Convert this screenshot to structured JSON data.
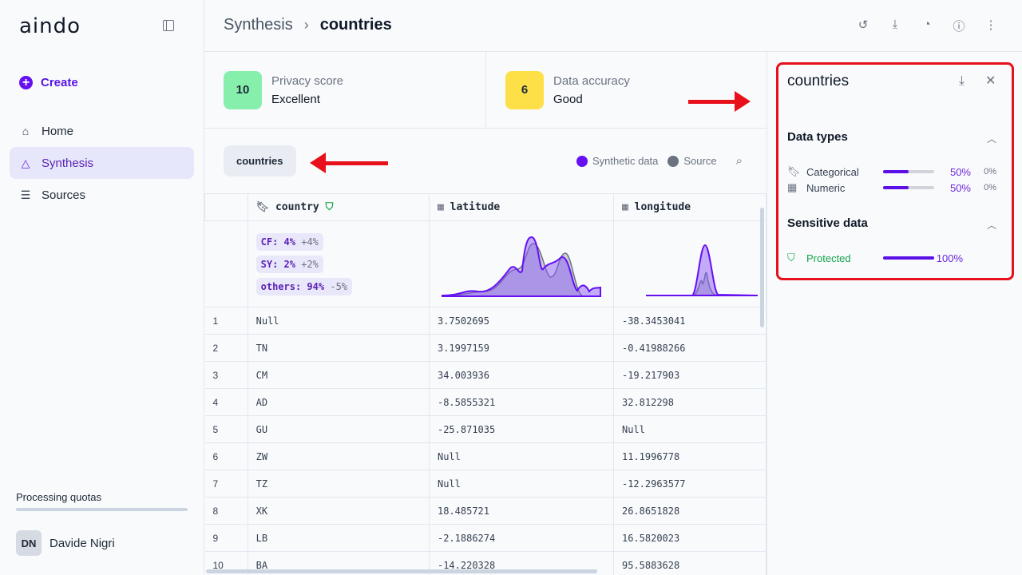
{
  "sidebar": {
    "logo": "aindo",
    "create": "Create",
    "items": [
      {
        "label": "Home",
        "icon": "home-icon"
      },
      {
        "label": "Synthesis",
        "icon": "shapes-icon",
        "active": true
      },
      {
        "label": "Sources",
        "icon": "database-icon"
      }
    ],
    "quota_label": "Processing quotas",
    "user": {
      "initials": "DN",
      "name": "Davide Nigri"
    }
  },
  "header": {
    "breadcrumb": [
      "Synthesis",
      "countries"
    ],
    "icons": [
      "history-icon",
      "download-icon",
      "pie-chart-icon",
      "info-icon",
      "more-vertical-icon"
    ]
  },
  "cards": [
    {
      "score": "10",
      "label": "Privacy score",
      "value": "Excellent",
      "color": "#86efac"
    },
    {
      "score": "6",
      "label": "Data accuracy",
      "value": "Good",
      "color": "#fde047"
    }
  ],
  "table_name": "countries",
  "legend": {
    "synthetic": "Synthetic data",
    "source": "Source",
    "synthetic_color": "#6610f2",
    "source_color": "#6b7280"
  },
  "columns": [
    {
      "name": "country",
      "type": "categorical"
    },
    {
      "name": "latitude",
      "type": "numeric"
    },
    {
      "name": "longitude",
      "type": "numeric"
    }
  ],
  "country_stats": [
    {
      "label": "CF: 4%",
      "delta": "+4%"
    },
    {
      "label": "SY: 2%",
      "delta": "+2%"
    },
    {
      "label": "others: 94%",
      "delta": "-5%"
    }
  ],
  "rows": [
    [
      "1",
      "Null",
      "3.7502695",
      "-38.3453041"
    ],
    [
      "2",
      "TN",
      "3.1997159",
      "-0.41988266"
    ],
    [
      "3",
      "CM",
      "34.003936",
      "-19.217903"
    ],
    [
      "4",
      "AD",
      "-8.5855321",
      "32.812298"
    ],
    [
      "5",
      "GU",
      "-25.871035",
      "Null"
    ],
    [
      "6",
      "ZW",
      "Null",
      "11.1996778"
    ],
    [
      "7",
      "TZ",
      "Null",
      "-12.2963577"
    ],
    [
      "8",
      "XK",
      "18.485721",
      "26.8651828"
    ],
    [
      "9",
      "LB",
      "-2.1886274",
      "16.5820023"
    ],
    [
      "10",
      "BA",
      "-14.220328",
      "95.5883628"
    ]
  ],
  "panel": {
    "title": "countries",
    "data_types_title": "Data types",
    "data_types": [
      {
        "name": "Categorical",
        "pct": "50%",
        "fill": 0.5,
        "delta": "0%"
      },
      {
        "name": "Numeric",
        "pct": "50%",
        "fill": 0.5,
        "delta": "0%"
      }
    ],
    "sensitive_title": "Sensitive data",
    "sensitive": {
      "name": "Protected",
      "pct": "100%",
      "fill": 1.0
    }
  }
}
